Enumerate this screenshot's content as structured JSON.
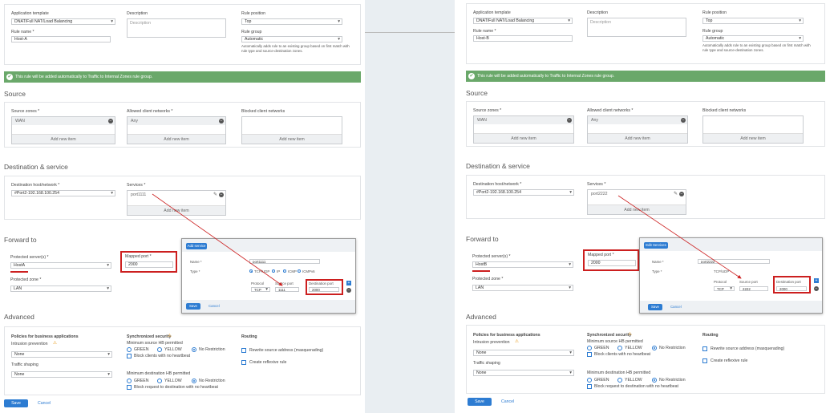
{
  "left": {
    "app_template_label": "Application template",
    "app_template_value": "DNAT/Full NAT/Load Balancing",
    "description_label": "Description",
    "description_placeholder": "Description",
    "rule_position_label": "Rule position",
    "rule_position_value": "Top",
    "rule_name_label": "Rule name *",
    "rule_name_value": "Host-A",
    "rule_group_label": "Rule group",
    "rule_group_value": "Automatic",
    "rule_group_help": "Automatically adds rule to an existing group based on first match with rule type and source-destination zones.",
    "banner": "This rule will be added automatically to Traffic to Internal Zones rule group.",
    "source_title": "Source",
    "source_zones_label": "Source zones *",
    "source_zones_item": "WAN",
    "allowed_label": "Allowed client networks *",
    "allowed_item": "Any",
    "blocked_label": "Blocked client networks",
    "add_new": "Add new item",
    "dest_title": "Destination & service",
    "dest_host_label": "Destination host/network *",
    "dest_host_value": "#Port2-192.168.100.254",
    "services_label": "Services *",
    "services_item": "port1111",
    "forward_title": "Forward to",
    "protected_label": "Protected server(s) *",
    "protected_value": "HostA",
    "mapped_label": "Mapped port *",
    "mapped_value": "2000",
    "zone_label": "Protected zone *",
    "zone_value": "LAN",
    "advanced_title": "Advanced",
    "policies_label": "Policies for business applications",
    "intrusion_label": "Intrusion prevention",
    "intrusion_value": "None",
    "traffic_label": "Traffic shaping",
    "traffic_value": "None",
    "sync_label": "Synchronized security",
    "min_src_label": "Minimum source HB permitted",
    "green": "GREEN",
    "yellow": "YELLOW",
    "norestr": "No Restriction",
    "block_clients": "Block clients with no heartbeat",
    "min_dst_label": "Minimum destination HB permitted",
    "block_req": "Block request to destination with no heartbeat",
    "routing_label": "Routing",
    "rewrite": "Rewrite source address (masquerading)",
    "reflexive": "Create reflexive rule",
    "save": "Save",
    "cancel": "Cancel",
    "dialog_title": "Add service",
    "dialog_name_label": "Name *",
    "dialog_name_value": "port1111",
    "dialog_type_label": "Type *",
    "dialog_type_opts": [
      "TCP/UDP",
      "IP",
      "ICMP",
      "ICMPv6"
    ],
    "dialog_protocol": "Protocol",
    "dialog_srcport": "Source port",
    "dialog_dstport": "Destination port",
    "dialog_proto_value": "TCP",
    "dialog_src_value": "1111",
    "dialog_dst_value": "2000",
    "dialog_save": "Save",
    "dialog_cancel": "Cancel"
  },
  "right": {
    "app_template_label": "Application template",
    "app_template_value": "DNAT/Full NAT/Load Balancing",
    "description_label": "Description",
    "description_placeholder": "Description",
    "rule_position_label": "Rule position",
    "rule_position_value": "Top",
    "rule_name_label": "Rule name *",
    "rule_name_value": "Host-B",
    "rule_group_label": "Rule group",
    "rule_group_value": "Automatic",
    "rule_group_help": "Automatically adds rule to an existing group based on first match with rule type and source-destination zones.",
    "banner": "This rule will be added automatically to Traffic to Internal Zones rule group.",
    "source_title": "Source",
    "source_zones_label": "Source zones *",
    "source_zones_item": "WAN",
    "allowed_label": "Allowed client networks *",
    "allowed_item": "Any",
    "blocked_label": "Blocked client networks",
    "add_new": "Add new item",
    "dest_title": "Destination & service",
    "dest_host_label": "Destination host/network *",
    "dest_host_value": "#Port2-192.168.100.254",
    "services_label": "Services *",
    "services_item": "port2222",
    "forward_title": "Forward to",
    "protected_label": "Protected server(s) *",
    "protected_value": "HostB",
    "mapped_label": "Mapped port *",
    "mapped_value": "2000",
    "zone_label": "Protected zone *",
    "zone_value": "LAN",
    "advanced_title": "Advanced",
    "policies_label": "Policies for business applications",
    "intrusion_label": "Intrusion prevention",
    "intrusion_value": "None",
    "traffic_label": "Traffic shaping",
    "traffic_value": "None",
    "sync_label": "Synchronized security",
    "min_src_label": "Minimum source HB permitted",
    "green": "GREEN",
    "yellow": "YELLOW",
    "norestr": "No Restriction",
    "block_clients": "Block clients with no heartbeat",
    "min_dst_label": "Minimum destination HB permitted",
    "block_req": "Block request to destination with no heartbeat",
    "routing_label": "Routing",
    "rewrite": "Rewrite source address (masquerading)",
    "reflexive": "Create reflexive rule",
    "save": "Save",
    "cancel": "Cancel",
    "dialog_title": "Edit Services",
    "dialog_name_label": "Name *",
    "dialog_name_value": "port2222",
    "dialog_type_label": "Type *",
    "dialog_type_value": "TCP/UDP",
    "dialog_protocol": "Protocol",
    "dialog_srcport": "Source port",
    "dialog_dstport": "Destination port",
    "dialog_proto_value": "TCP",
    "dialog_src_value": "2222",
    "dialog_dst_value": "2000",
    "dialog_save": "Save",
    "dialog_cancel": "Cancel"
  },
  "colors": {
    "accent": "#2d7cd2",
    "banner": "#6aa86a",
    "highlight": "#cc1f1f"
  }
}
